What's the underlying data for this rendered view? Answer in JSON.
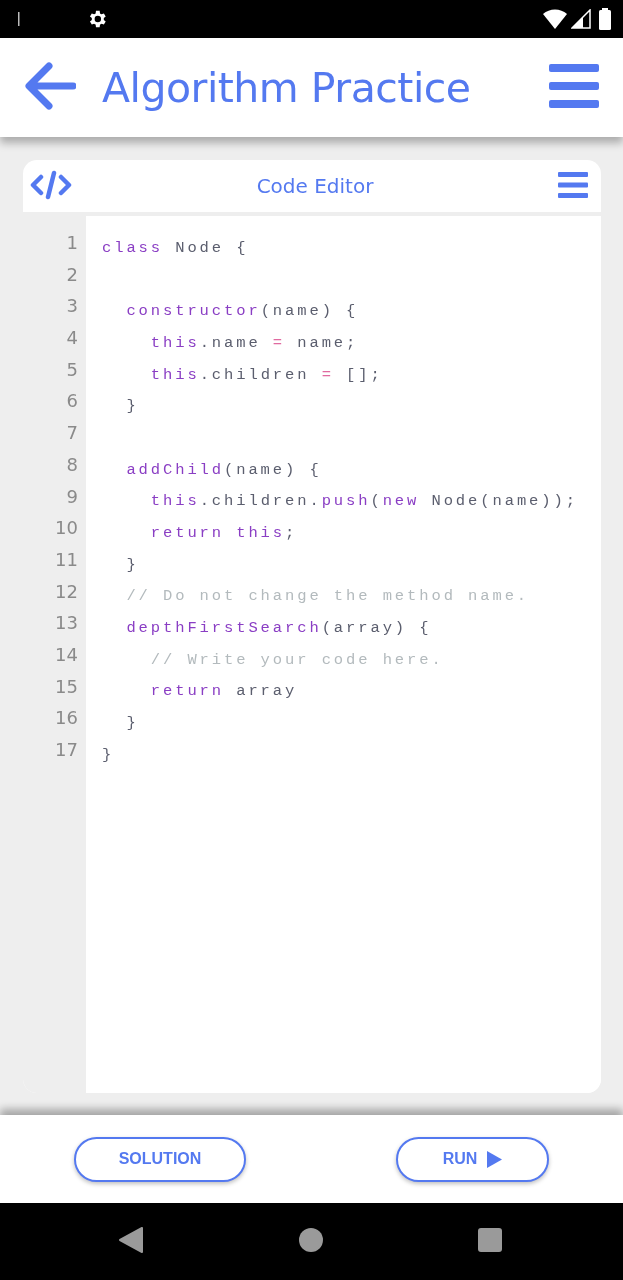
{
  "app_bar": {
    "title": "Algorithm Practice"
  },
  "editor": {
    "title": "Code Editor",
    "lines": [
      {
        "number": "1",
        "tokens": [
          {
            "kind": "keyword",
            "text": "class"
          },
          {
            "kind": "plain",
            "text": " Node {"
          }
        ]
      },
      {
        "number": "2"
      },
      {
        "number": "3",
        "tokens": [
          {
            "kind": "keyword",
            "text": "  constructor"
          },
          {
            "kind": "plain",
            "text": "(name) {"
          }
        ]
      },
      {
        "number": "4",
        "tokens": [
          {
            "kind": "keyword",
            "text": "    this"
          },
          {
            "kind": "plain",
            "text": ".name "
          },
          {
            "kind": "operator",
            "text": "="
          },
          {
            "kind": "plain",
            "text": " name;"
          }
        ]
      },
      {
        "number": "5",
        "tokens": [
          {
            "kind": "keyword",
            "text": "    this"
          },
          {
            "kind": "plain",
            "text": ".children "
          },
          {
            "kind": "operator",
            "text": "="
          },
          {
            "kind": "plain",
            "text": " [];"
          }
        ]
      },
      {
        "number": "6",
        "tokens": [
          {
            "kind": "plain",
            "text": "  }"
          }
        ]
      },
      {
        "number": "7"
      },
      {
        "number": "8",
        "tokens": [
          {
            "kind": "keyword",
            "text": "  addChild"
          },
          {
            "kind": "plain",
            "text": "(name) {"
          }
        ]
      },
      {
        "number": "9",
        "tokens": [
          {
            "kind": "keyword",
            "text": "    this"
          },
          {
            "kind": "plain",
            "text": ".children."
          },
          {
            "kind": "keyword",
            "text": "push"
          },
          {
            "kind": "plain",
            "text": "("
          },
          {
            "kind": "keyword",
            "text": "new"
          },
          {
            "kind": "plain",
            "text": " Node(name));"
          }
        ]
      },
      {
        "number": "10",
        "tokens": [
          {
            "kind": "keyword",
            "text": "    return this"
          },
          {
            "kind": "plain",
            "text": ";"
          }
        ]
      },
      {
        "number": "11",
        "tokens": [
          {
            "kind": "plain",
            "text": "  }"
          }
        ]
      },
      {
        "number": "12",
        "tokens": [
          {
            "kind": "comment",
            "text": "  // Do not change the method name."
          }
        ]
      },
      {
        "number": "13",
        "tokens": [
          {
            "kind": "keyword",
            "text": "  depthFirstSearch"
          },
          {
            "kind": "plain",
            "text": "(array) {"
          }
        ]
      },
      {
        "number": "14",
        "tokens": [
          {
            "kind": "comment",
            "text": "    // Write your code here."
          }
        ]
      },
      {
        "number": "15",
        "tokens": [
          {
            "kind": "keyword",
            "text": "    return"
          },
          {
            "kind": "plain",
            "text": " array"
          }
        ]
      },
      {
        "number": "16",
        "tokens": [
          {
            "kind": "plain",
            "text": "  }"
          }
        ]
      },
      {
        "number": "17",
        "tokens": [
          {
            "kind": "plain",
            "text": "}"
          }
        ]
      }
    ]
  },
  "buttons": [
    {
      "label": "SOLUTION",
      "kind": "plain"
    },
    {
      "label": "RUN",
      "kind": "run"
    }
  ]
}
